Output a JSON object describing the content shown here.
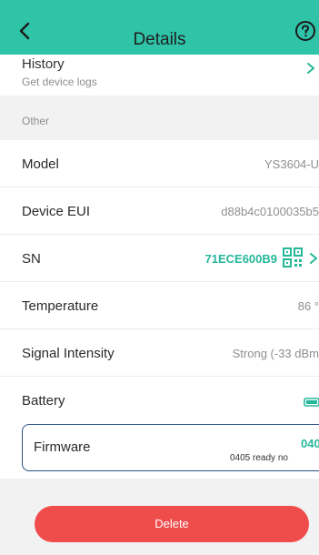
{
  "header": {
    "title": "Details",
    "back_icon": "chevron-left-icon",
    "help_icon": "help-circle-icon"
  },
  "history": {
    "label": "History",
    "sub": "Get device logs"
  },
  "section": {
    "other_label": "Other"
  },
  "rows": {
    "model": {
      "label": "Model",
      "value": "YS3604-U"
    },
    "eui": {
      "label": "Device EUI",
      "value": "d88b4c0100035b5"
    },
    "sn": {
      "label": "SN",
      "value": "71ECE600B9"
    },
    "temperature": {
      "label": "Temperature",
      "value": "86 °"
    },
    "signal": {
      "label": "Signal Intensity",
      "value": "Strong (-33 dBm"
    },
    "battery": {
      "label": "Battery"
    }
  },
  "firmware": {
    "label": "Firmware",
    "version": "040",
    "note": "0405 ready no"
  },
  "actions": {
    "delete_label": "Delete"
  },
  "colors": {
    "header": "#2fc3a7",
    "accent_green": "#25b79a",
    "danger": "#ef4c4c",
    "focus_border": "#2b4f86"
  }
}
